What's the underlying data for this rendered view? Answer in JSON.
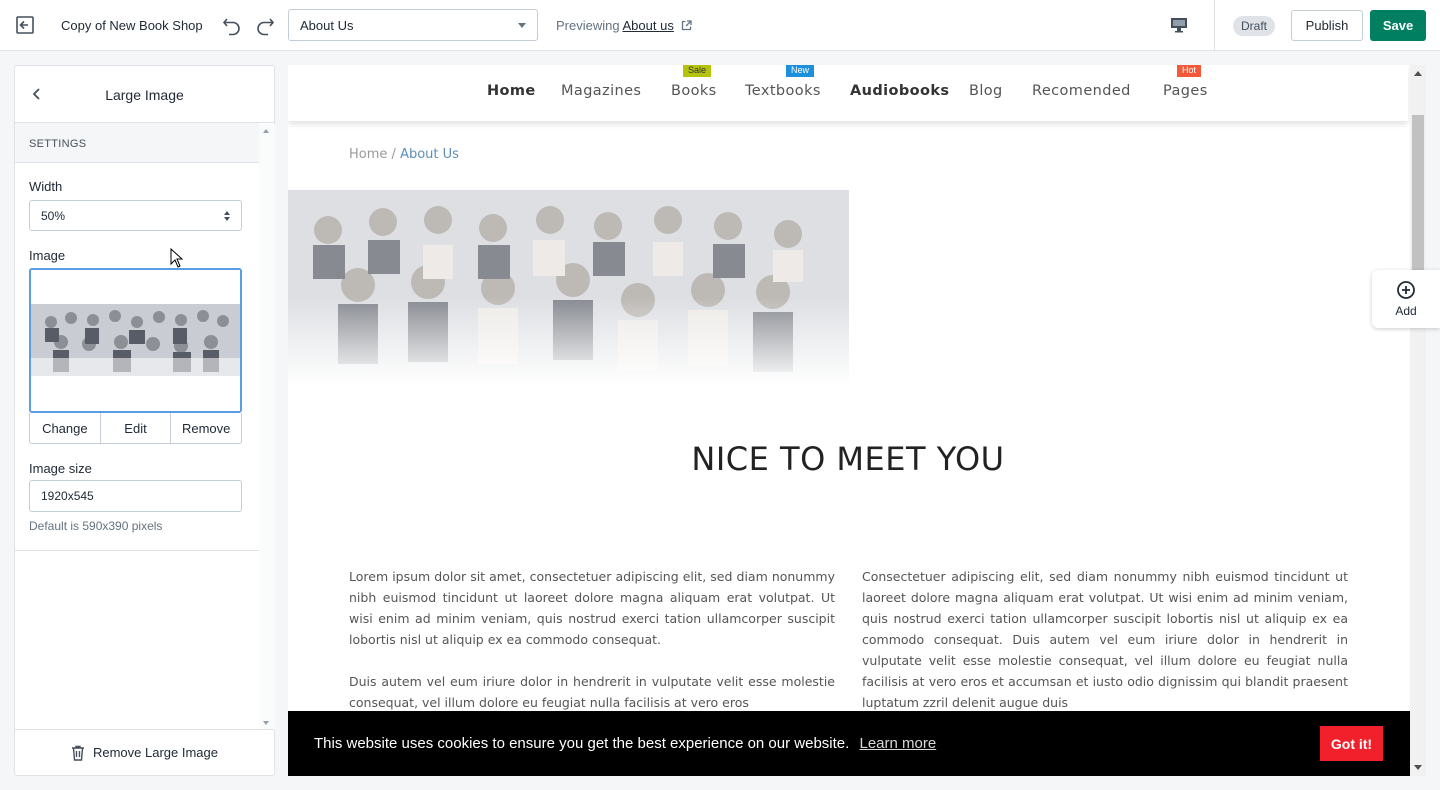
{
  "topbar": {
    "shop_name": "Copy of New Book Shop",
    "page_select": "About Us",
    "preview_prefix": "Previewing",
    "preview_link": "About us",
    "draft_badge": "Draft",
    "publish_label": "Publish",
    "save_label": "Save"
  },
  "sidebar": {
    "title": "Large Image",
    "section": "SETTINGS",
    "width_label": "Width",
    "width_value": "50%",
    "image_label": "Image",
    "change_label": "Change",
    "edit_label": "Edit",
    "remove_label": "Remove",
    "image_size_label": "Image size",
    "image_size_value": "1920x545",
    "image_size_help": "Default is 590x390 pixels",
    "remove_section_label": "Remove Large Image"
  },
  "preview": {
    "nav": [
      {
        "label": "Home",
        "bold": true
      },
      {
        "label": "Magazines",
        "bold": false
      },
      {
        "label": "Books",
        "bold": false,
        "badge": "Sale",
        "badge_color": "#b5c30b"
      },
      {
        "label": "Textbooks",
        "bold": false,
        "badge": "New",
        "badge_color": "#1d8fdb"
      },
      {
        "label": "Audiobooks",
        "bold": true
      },
      {
        "label": "Blog",
        "bold": false
      },
      {
        "label": "Recomended",
        "bold": false
      },
      {
        "label": "Pages",
        "bold": false,
        "badge": "Hot",
        "badge_color": "#f25a3a"
      }
    ],
    "breadcrumb_home": "Home",
    "breadcrumb_sep": "/",
    "breadcrumb_current": "About Us",
    "heading": "NICE TO MEET YOU",
    "col1_p1": "Lorem ipsum dolor sit amet, consectetuer adipiscing elit, sed diam nonummy nibh euismod tincidunt ut laoreet dolore magna aliquam erat volutpat. Ut wisi enim ad minim veniam, quis nostrud exerci tation ullamcorper suscipit lobortis nisl ut aliquip ex ea commodo consequat.",
    "col1_p2": "Duis autem vel eum iriure dolor in hendrerit in vulputate velit esse molestie consequat, vel illum dolore eu feugiat nulla facilisis at vero eros",
    "col2_p1": "Consectetuer adipiscing elit, sed diam nonummy nibh euismod tincidunt ut laoreet dolore magna aliquam erat volutpat. Ut wisi enim ad minim veniam, quis nostrud exerci tation ullamcorper suscipit lobortis nisl ut aliquip ex ea commodo consequat. Duis autem vel eum iriure dolor in hendrerit in vulputate velit esse molestie consequat, vel illum dolore eu feugiat nulla facilisis at vero eros et accumsan et iusto odio dignissim qui blandit praesent luptatum zzril delenit augue duis",
    "cookie_text": "This website uses cookies to ensure you get the best experience on our website.",
    "cookie_link": "Learn more",
    "cookie_button": "Got it!"
  },
  "add_label": "Add",
  "colors": {
    "accent": "#008060",
    "focus": "#5c9ce6",
    "cookie_button": "#f1202b"
  }
}
